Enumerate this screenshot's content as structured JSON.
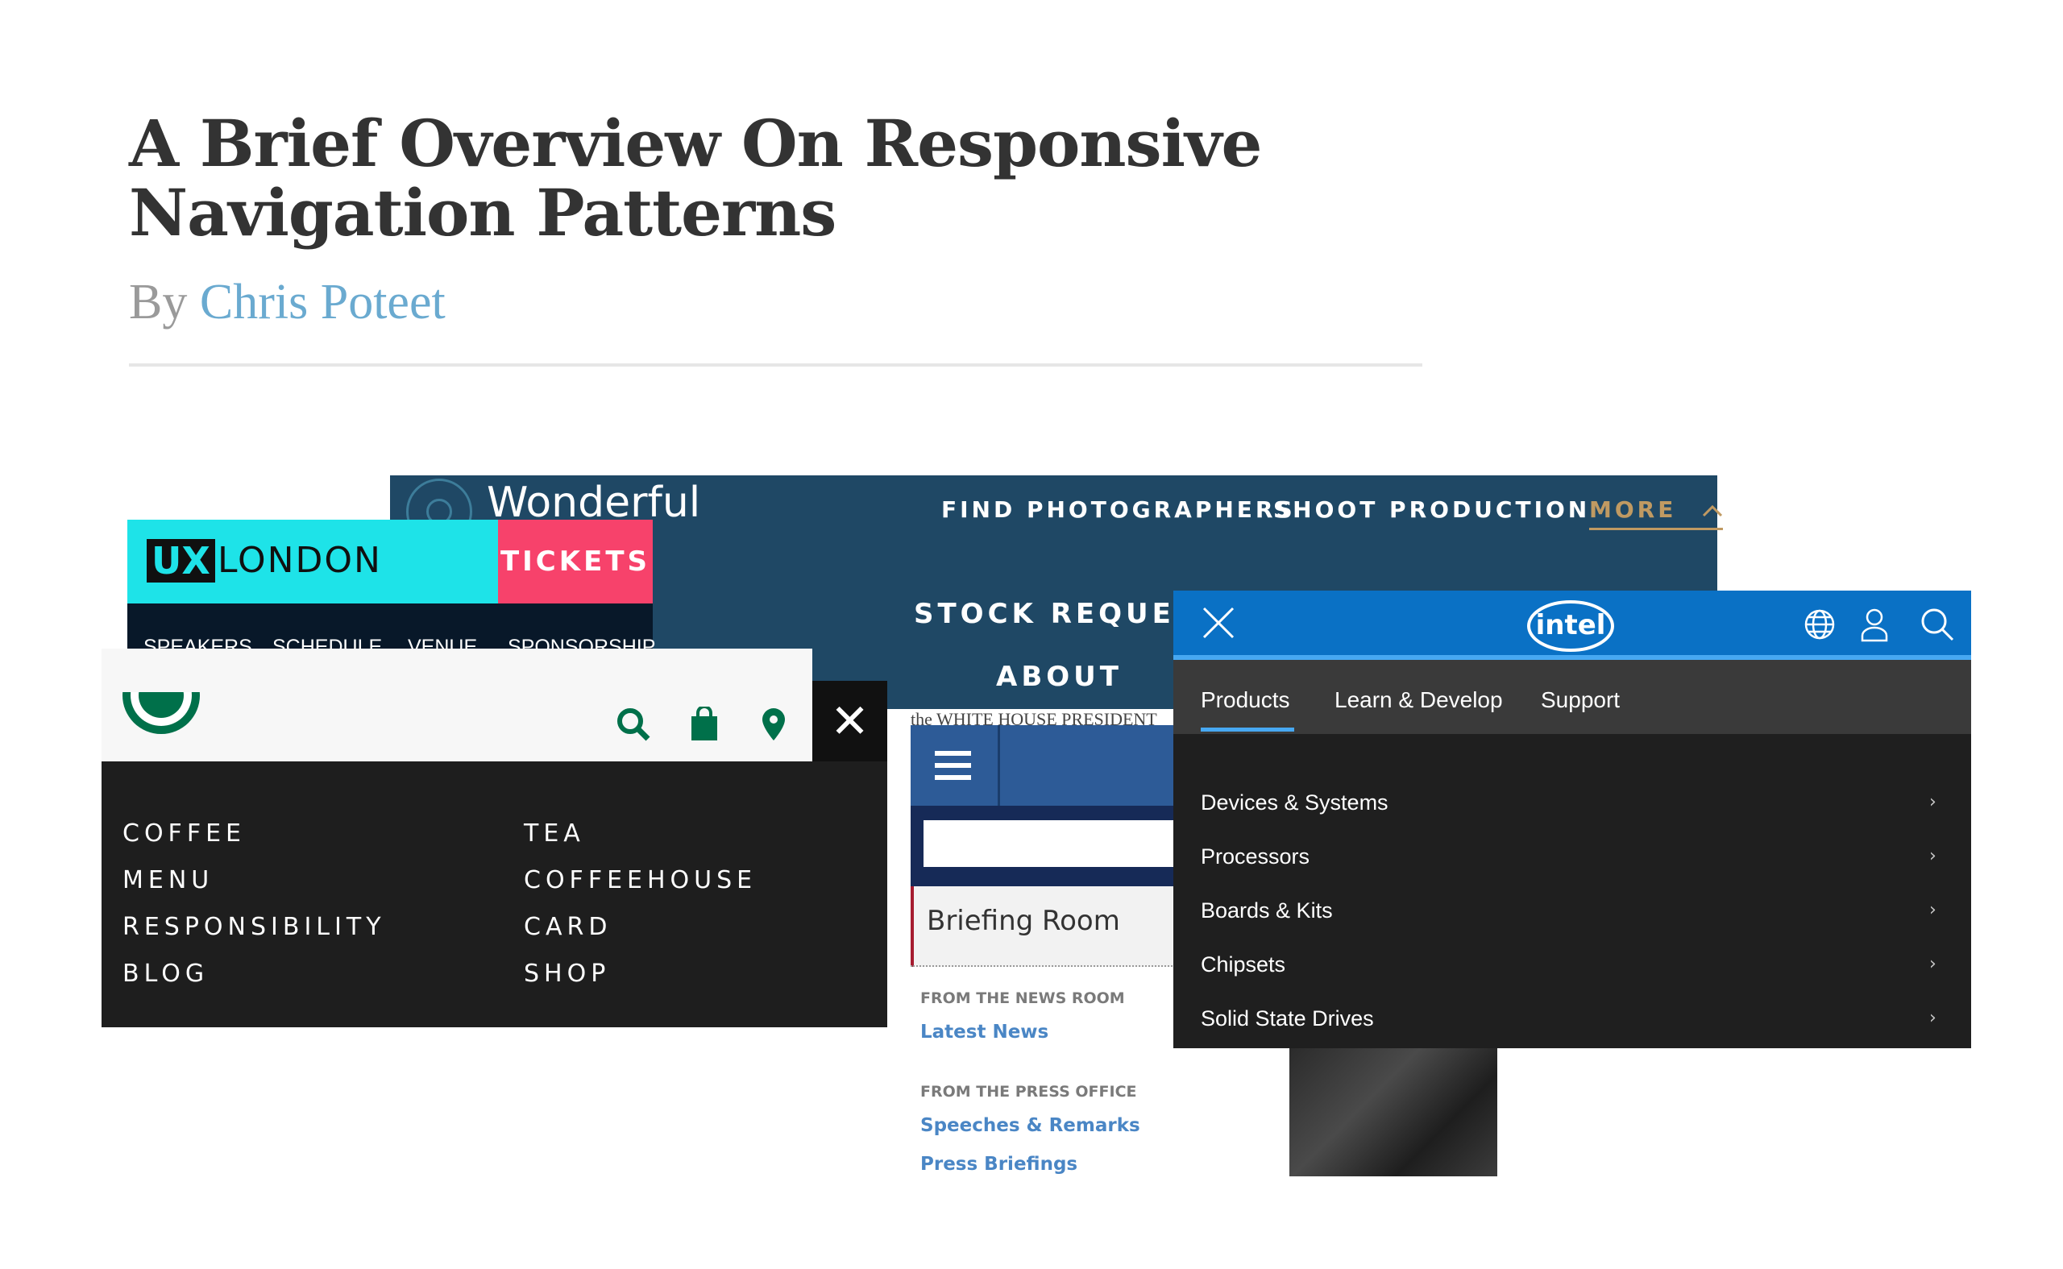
{
  "article": {
    "title_line1": "A Brief Overview On Responsive",
    "title_line2": "Navigation Patterns",
    "by": "By",
    "author": "Chris Poteet"
  },
  "wonderful": {
    "brand": "Wonderful",
    "nav": [
      "FIND PHOTOGRAPHERS",
      "SHOOT PRODUCTION",
      "MORE"
    ],
    "more_icon": "chevron-up-icon",
    "submenu": [
      "STOCK REQUESTS",
      "ABOUT"
    ]
  },
  "uxlondon": {
    "ux": "UX",
    "london": "LONDON",
    "tickets": "TICKETS",
    "nav": [
      "SPEAKERS",
      "SCHEDULE",
      "VENUE",
      "SPONSORSHIP"
    ]
  },
  "starbucks": {
    "icons": [
      "search-icon",
      "bag-icon",
      "location-pin-icon"
    ],
    "close": "✕",
    "col1": [
      "COFFEE",
      "MENU",
      "RESPONSIBILITY",
      "BLOG"
    ],
    "col2": [
      "TEA",
      "COFFEEHOUSE",
      "CARD",
      "SHOP"
    ],
    "accent": "#00704a"
  },
  "whitehouse": {
    "header": "the WHITE HOUSE  PRESIDENT",
    "room": "Briefing Room",
    "sections": [
      {
        "caption": "FROM THE NEWS ROOM",
        "links": [
          "Latest News"
        ]
      },
      {
        "caption": "FROM THE PRESS OFFICE",
        "links": [
          "Speeches & Remarks",
          "Press Briefings"
        ]
      }
    ]
  },
  "intel": {
    "logo": "intel",
    "tabs": [
      "Products",
      "Learn & Develop",
      "Support"
    ],
    "items": [
      "Devices & Systems",
      "Processors",
      "Boards & Kits",
      "Chipsets",
      "Solid State Drives"
    ],
    "chevron": "›",
    "colors": {
      "bar": "#0a71c5",
      "accent": "#47a8f2"
    }
  }
}
